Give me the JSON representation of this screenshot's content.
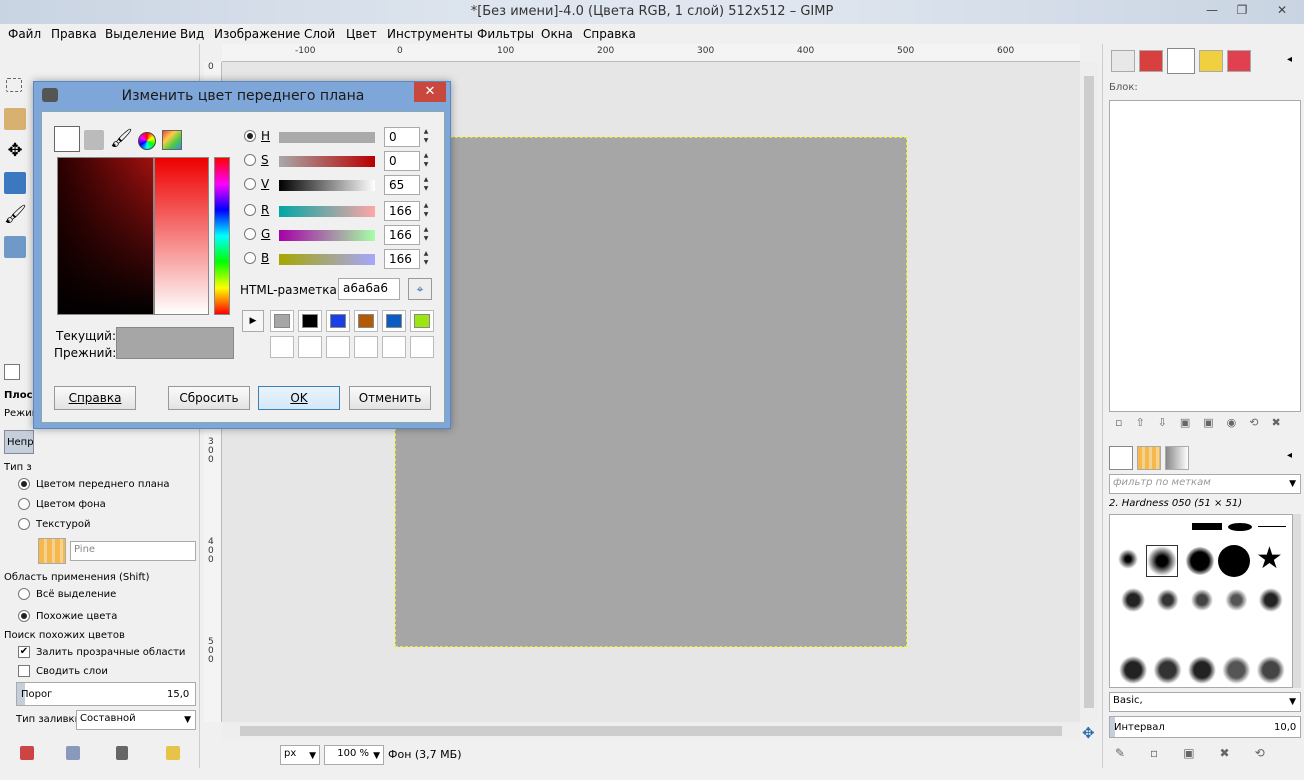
{
  "window": {
    "title": "*[Без имени]-4.0 (Цвета RGB, 1 слой) 512x512 – GIMP"
  },
  "menu": [
    {
      "label": "Файл"
    },
    {
      "label": "Правка"
    },
    {
      "label": "Выделение"
    },
    {
      "label": "Вид"
    },
    {
      "label": "Изображение"
    },
    {
      "label": "Слой"
    },
    {
      "label": "Цвет"
    },
    {
      "label": "Инструменты"
    },
    {
      "label": "Фильтры"
    },
    {
      "label": "Окна"
    },
    {
      "label": "Справка"
    }
  ],
  "rulers": {
    "h": [
      "-100",
      "0",
      "100",
      "200",
      "300",
      "400",
      "500",
      "600"
    ],
    "v_top": "0",
    "v_mid1": "3\n0\n0",
    "v_mid2": "4\n0\n0",
    "v_mid3": "5\n0\n0"
  },
  "tool_options": {
    "title_partial": "Плоск",
    "mode_label_partial": "Режим",
    "mode_value_partial": "Непр",
    "fill_type_label_partial": "Тип з",
    "fill_fg": "Цветом переднего плана",
    "fill_bg": "Цветом фона",
    "fill_pattern": "Текстурой",
    "pattern_name": "Pine",
    "area_label": "Область применения (Shift)",
    "area_selection": "Всё выделение",
    "area_similar": "Похожие цвета",
    "search_label": "Поиск похожих цветов",
    "fill_transparent": "Залить прозрачные области",
    "sample_merged": "Сводить слои",
    "threshold_label": "Порог",
    "threshold_value": "15,0",
    "fill_by_label": "Тип заливки:",
    "fill_by_value": "Составной"
  },
  "dialog": {
    "title": "Изменить цвет переднего плана",
    "channels": [
      {
        "key": "H",
        "value": "0",
        "selected": true
      },
      {
        "key": "S",
        "value": "0",
        "selected": false
      },
      {
        "key": "V",
        "value": "65",
        "selected": false
      },
      {
        "key": "R",
        "value": "166",
        "selected": false
      },
      {
        "key": "G",
        "value": "166",
        "selected": false
      },
      {
        "key": "B",
        "value": "166",
        "selected": false
      }
    ],
    "html_label": "HTML-разметка:",
    "html_value": "a6a6a6",
    "current_label": "Текущий:",
    "previous_label": "Прежний:",
    "current_color": "#a6a6a6",
    "history": [
      "#a6a6a6",
      "#000000",
      "#1a3fe6",
      "#b35a06",
      "#0d5cc4",
      "#9be610"
    ],
    "buttons": {
      "help": "Справка",
      "reset": "Сбросить",
      "ok": "OK",
      "cancel": "Отменить"
    }
  },
  "statusbar": {
    "unit": "px",
    "zoom": "100 %",
    "info": "Фон (3,7 МБ)"
  },
  "right_dock": {
    "channels_label": "Блок:",
    "brush_filter_placeholder": "фильтр по меткам",
    "brush_name": "2. Hardness 050 (51 × 51)",
    "brush_set": "Basic,",
    "spacing_label": "Интервал",
    "spacing_value": "10,0"
  }
}
